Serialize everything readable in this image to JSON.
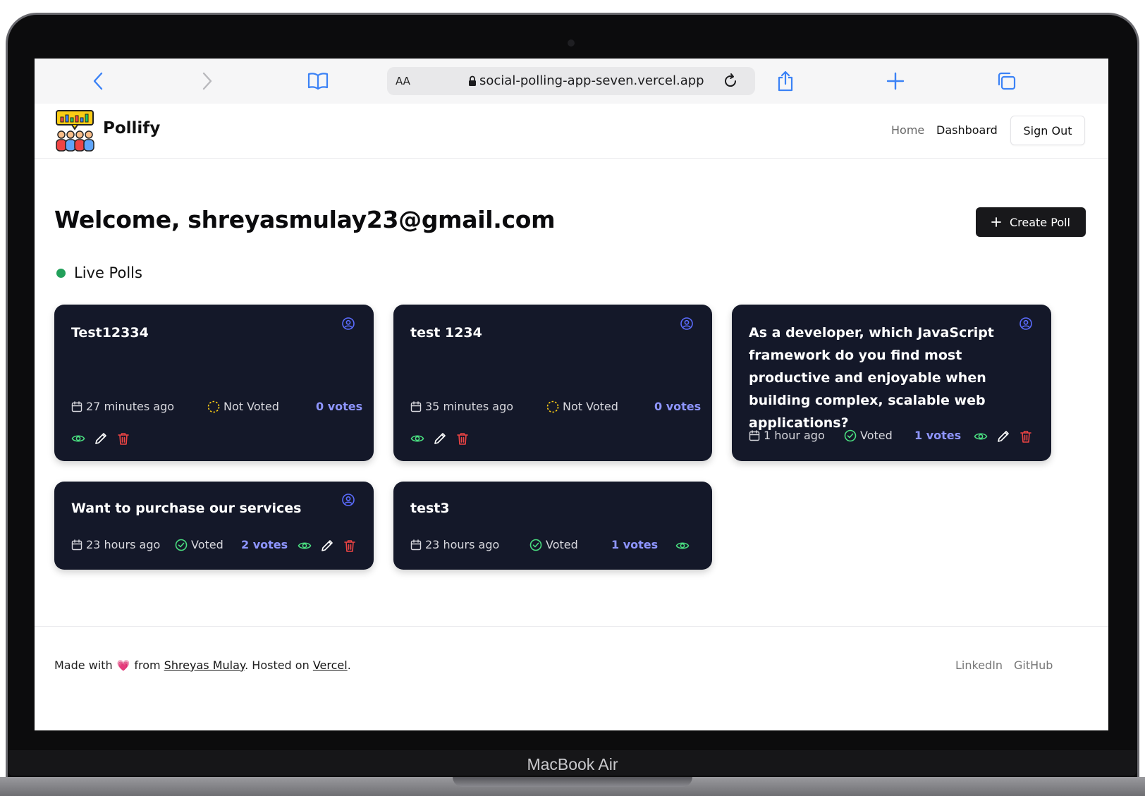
{
  "device": {
    "label": "MacBook Air"
  },
  "browser": {
    "text_size_label": "AA",
    "url": "social-polling-app-seven.vercel.app"
  },
  "header": {
    "brand": "Pollify",
    "nav": {
      "home": "Home",
      "dashboard": "Dashboard"
    },
    "sign_out": "Sign Out"
  },
  "main": {
    "welcome": "Welcome, shreyasmulay23@gmail.com",
    "create_poll": "Create Poll",
    "section_title": "Live Polls"
  },
  "polls": [
    {
      "title": "Test12334",
      "time": "27 minutes ago",
      "status": "Not Voted",
      "votes": "0 votes",
      "can_edit": true
    },
    {
      "title": "test 1234",
      "time": "35 minutes ago",
      "status": "Not Voted",
      "votes": "0 votes",
      "can_edit": true
    },
    {
      "title": "As a developer, which JavaScript framework do you find most productive and enjoyable when building complex, scalable web applications?",
      "time": "1 hour ago",
      "status": "Voted",
      "votes": "1 votes",
      "can_edit": true
    },
    {
      "title": "Want to purchase our services",
      "time": "23 hours ago",
      "status": "Voted",
      "votes": "2 votes",
      "can_edit": true
    },
    {
      "title": "test3",
      "time": "23 hours ago",
      "status": "Voted",
      "votes": "1 votes",
      "can_edit": false
    }
  ],
  "footer": {
    "made_with": "Made with",
    "from": "from",
    "author": "Shreyas Mulay",
    "hosted_on": ". Hosted on",
    "host": "Vercel",
    "period": ".",
    "links": {
      "linkedin": "LinkedIn",
      "github": "GitHub"
    }
  },
  "colors": {
    "card_bg": "#141829",
    "votes": "#8e95ff",
    "voted_green": "#4ade80",
    "not_voted_yellow": "#facc15",
    "delete_red": "#ef4444",
    "live_dot": "#22a05a",
    "user_icon_blue": "#5b6cff"
  },
  "icons": {
    "back": "chevron-left-icon",
    "forward": "chevron-right-icon",
    "bookmarks": "book-icon",
    "reload": "reload-icon",
    "share": "share-icon",
    "new_tab": "plus-icon",
    "tabs": "tabs-icon",
    "calendar": "calendar-icon",
    "view": "eye-icon",
    "edit": "pencil-icon",
    "delete": "trash-icon",
    "owner": "user-circle-icon"
  }
}
